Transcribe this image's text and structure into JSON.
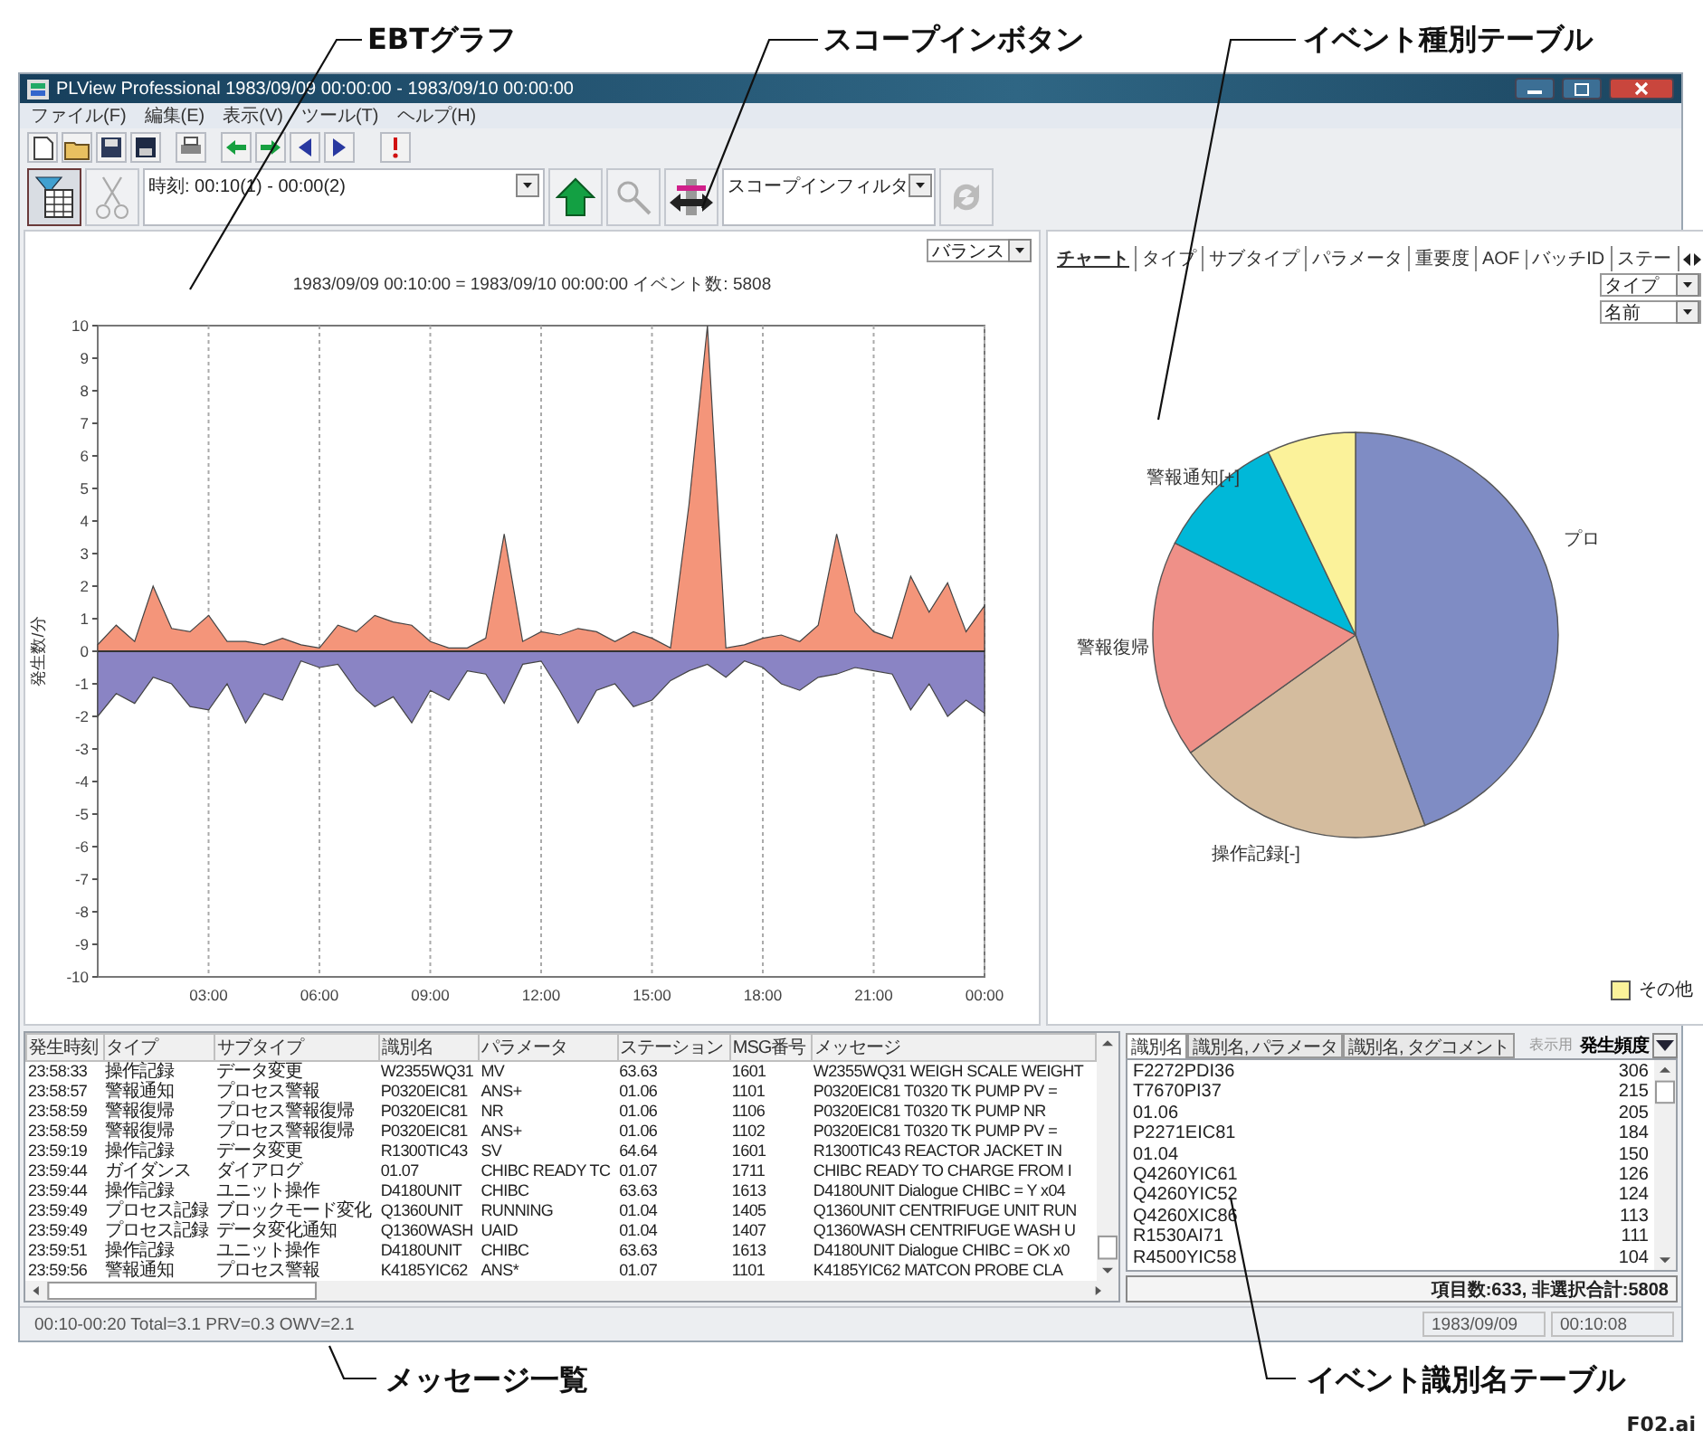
{
  "annotations": [
    {
      "text": "EBTグラフ"
    },
    {
      "text": "スコープインボタン"
    },
    {
      "text": "イベント種別テーブル"
    },
    {
      "text": "メッセージ一覧"
    },
    {
      "text": "イベント識別名テーブル"
    }
  ],
  "figure_id": "F02.ai",
  "window": {
    "title": "PLView Professional 1983/09/09 00:00:00 - 1983/09/10 00:00:00"
  },
  "menu": [
    "ファイル(F)",
    "編集(E)",
    "表示(V)",
    "ツール(T)",
    "ヘルプ(H)"
  ],
  "time_range": {
    "value": "時刻: 00:10(1) - 00:00(2)"
  },
  "scope_filter": {
    "value": "スコープインフィルタ"
  },
  "ebt": {
    "mode": "バランス",
    "title": "1983/09/09 00:10:00 = 1983/09/10 00:00:00 イベント数: 5808",
    "chart_data": {
      "type": "area",
      "ylabel": "発生数/分",
      "x": [
        0,
        0.5,
        1,
        1.5,
        2,
        2.5,
        3,
        3.5,
        4,
        4.5,
        5,
        5.5,
        6,
        6.5,
        7,
        7.5,
        8,
        8.5,
        9,
        9.5,
        10,
        10.5,
        11,
        11.5,
        12,
        12.5,
        13,
        13.5,
        14,
        14.5,
        15,
        15.5,
        16,
        16.5,
        17,
        17.5,
        18,
        18.5,
        19,
        19.5,
        20,
        20.5,
        21,
        21.5,
        22,
        22.5,
        23,
        23.5,
        24
      ],
      "series": [
        {
          "color": "#f4957a",
          "values": [
            0.2,
            0.8,
            0.3,
            2.0,
            0.7,
            0.6,
            1.1,
            0.3,
            0.3,
            0.2,
            0.4,
            0.2,
            0.1,
            0.8,
            0.6,
            1.1,
            0.9,
            0.8,
            0.3,
            0.1,
            0.1,
            0.4,
            3.6,
            0.3,
            0.6,
            0.5,
            0.7,
            0.6,
            0.3,
            0.6,
            0.4,
            0.1,
            4.5,
            10,
            0.1,
            0.2,
            0.4,
            0.5,
            0.3,
            0.8,
            3.6,
            1.2,
            0.6,
            0.4,
            2.3,
            1.2,
            2.1,
            0.6,
            1.4
          ]
        },
        {
          "color": "#8a84c4",
          "values": [
            -2.0,
            -1.3,
            -1.6,
            -0.8,
            -1.0,
            -1.7,
            -1.8,
            -1.0,
            -2.2,
            -1.3,
            -1.5,
            -0.3,
            -0.5,
            -0.4,
            -1.2,
            -1.7,
            -1.4,
            -2.2,
            -1.2,
            -1.5,
            -0.6,
            -0.7,
            -1.6,
            -0.4,
            -0.3,
            -1.2,
            -2.2,
            -1.2,
            -1.0,
            -1.7,
            -1.5,
            -0.9,
            -0.6,
            -0.4,
            -0.8,
            -0.3,
            -0.5,
            -1.0,
            -1.2,
            -0.8,
            -0.7,
            -0.5,
            -0.6,
            -0.7,
            -1.8,
            -1.0,
            -2.0,
            -1.5,
            -1.9
          ]
        }
      ],
      "xlim": [
        0,
        24
      ],
      "ylim": [
        -10,
        10
      ],
      "xticks": [
        {
          "value": 3,
          "label": "03:00"
        },
        {
          "value": 6,
          "label": "06:00"
        },
        {
          "value": 9,
          "label": "09:00"
        },
        {
          "value": 12,
          "label": "12:00"
        },
        {
          "value": 15,
          "label": "15:00"
        },
        {
          "value": 18,
          "label": "18:00"
        },
        {
          "value": 21,
          "label": "21:00"
        },
        {
          "value": 24,
          "label": "00:00"
        }
      ],
      "yticks": [
        -10,
        -9,
        -8,
        -7,
        -6,
        -5,
        -4,
        -3,
        -2,
        -1,
        0,
        1,
        2,
        3,
        4,
        5,
        6,
        7,
        8,
        9,
        10
      ],
      "grid": true
    }
  },
  "event_type": {
    "tabs": [
      {
        "label": "チャート",
        "selected": true
      },
      {
        "label": "タイプ",
        "selected": false
      },
      {
        "label": "サブタイプ",
        "selected": false
      },
      {
        "label": "パラメータ",
        "selected": false
      },
      {
        "label": "重要度",
        "selected": false
      },
      {
        "label": "AOF",
        "selected": false
      },
      {
        "label": "バッチID",
        "selected": false
      },
      {
        "label": "ステー",
        "selected": false
      }
    ],
    "group_select": "タイプ",
    "sort_select": "名前",
    "pie_labels": [
      "プロ",
      "操作記録[-]",
      "警報復帰",
      "警報通知[+]"
    ],
    "legend": [
      {
        "label": "その他",
        "color": "#fbf29a"
      }
    ]
  },
  "messages": {
    "columns": [
      "発生時刻",
      "タイプ",
      "サブタイプ",
      "識別名",
      "パラメータ",
      "ステーション",
      "MSG番号",
      "メッセージ"
    ],
    "rows": [
      [
        "23:58:33",
        "操作記録",
        "データ変更",
        "W2355WQ31",
        "MV",
        "63.63",
        "1601",
        "W2355WQ31 WEIGH SCALE WEIGHT"
      ],
      [
        "23:58:57",
        "警報通知",
        "プロセス警報",
        "P0320EIC81",
        "ANS+",
        "01.06",
        "1101",
        "P0320EIC81 T0320 TK PUMP PV ="
      ],
      [
        "23:58:59",
        "警報復帰",
        "プロセス警報復帰",
        "P0320EIC81",
        "NR",
        "01.06",
        "1106",
        "P0320EIC81 T0320 TK PUMP NR"
      ],
      [
        "23:58:59",
        "警報復帰",
        "プロセス警報復帰",
        "P0320EIC81",
        "ANS+",
        "01.06",
        "1102",
        "P0320EIC81 T0320 TK PUMP PV ="
      ],
      [
        "23:59:19",
        "操作記録",
        "データ変更",
        "R1300TIC43",
        "SV",
        "64.64",
        "1601",
        "R1300TIC43 REACTOR JACKET IN"
      ],
      [
        "23:59:44",
        "ガイダンス",
        "ダイアログ",
        "01.07",
        "CHIBC READY TC",
        "01.07",
        "1711",
        "CHIBC READY TO CHARGE FROM I"
      ],
      [
        "23:59:44",
        "操作記録",
        "ユニット操作",
        "D4180UNIT",
        "CHIBC",
        "63.63",
        "1613",
        "D4180UNIT Dialogue CHIBC = Y x04"
      ],
      [
        "23:59:49",
        "プロセス記録",
        "ブロックモード変化",
        "Q1360UNIT",
        "RUNNING",
        "01.04",
        "1405",
        "Q1360UNIT CENTRIFUGE UNIT RUN"
      ],
      [
        "23:59:49",
        "プロセス記録",
        "データ変化通知",
        "Q1360WASH",
        "UAID",
        "01.04",
        "1407",
        "Q1360WASH CENTRIFUGE WASH U"
      ],
      [
        "23:59:51",
        "操作記録",
        "ユニット操作",
        "D4180UNIT",
        "CHIBC",
        "63.63",
        "1613",
        "D4180UNIT Dialogue CHIBC = OK x0"
      ],
      [
        "23:59:56",
        "警報通知",
        "プロセス警報",
        "K4185YIC62",
        "ANS*",
        "01.07",
        "1101",
        "K4185YIC62 MATCON PROBE CLA"
      ]
    ]
  },
  "identifiers": {
    "tabs": [
      {
        "label": "識別名",
        "selected": true
      },
      {
        "label": "識別名, パラメータ",
        "selected": false
      },
      {
        "label": "識別名, タグコメント",
        "selected": false
      }
    ],
    "display_label": "表示用",
    "sort_label": "発生頻度",
    "rows": [
      {
        "name": "F2272PDI36",
        "count": "306"
      },
      {
        "name": "T7670PI37",
        "count": "215"
      },
      {
        "name": "01.06",
        "count": "205"
      },
      {
        "name": "P2271EIC81",
        "count": "184"
      },
      {
        "name": "01.04",
        "count": "150"
      },
      {
        "name": "Q4260YIC61",
        "count": "126"
      },
      {
        "name": "Q4260YIC52",
        "count": "124"
      },
      {
        "name": "Q4260XIC86",
        "count": "113"
      },
      {
        "name": "R1530AI71",
        "count": "111"
      },
      {
        "name": "R4500YIC58",
        "count": "104"
      }
    ],
    "summary": "項目数:633, 非選択合計:5808"
  },
  "status_bar": [
    "00:10-00:20 Total=3.1 PRV=0.3 OWV=2.1",
    "1983/09/09",
    "00:10:08"
  ]
}
